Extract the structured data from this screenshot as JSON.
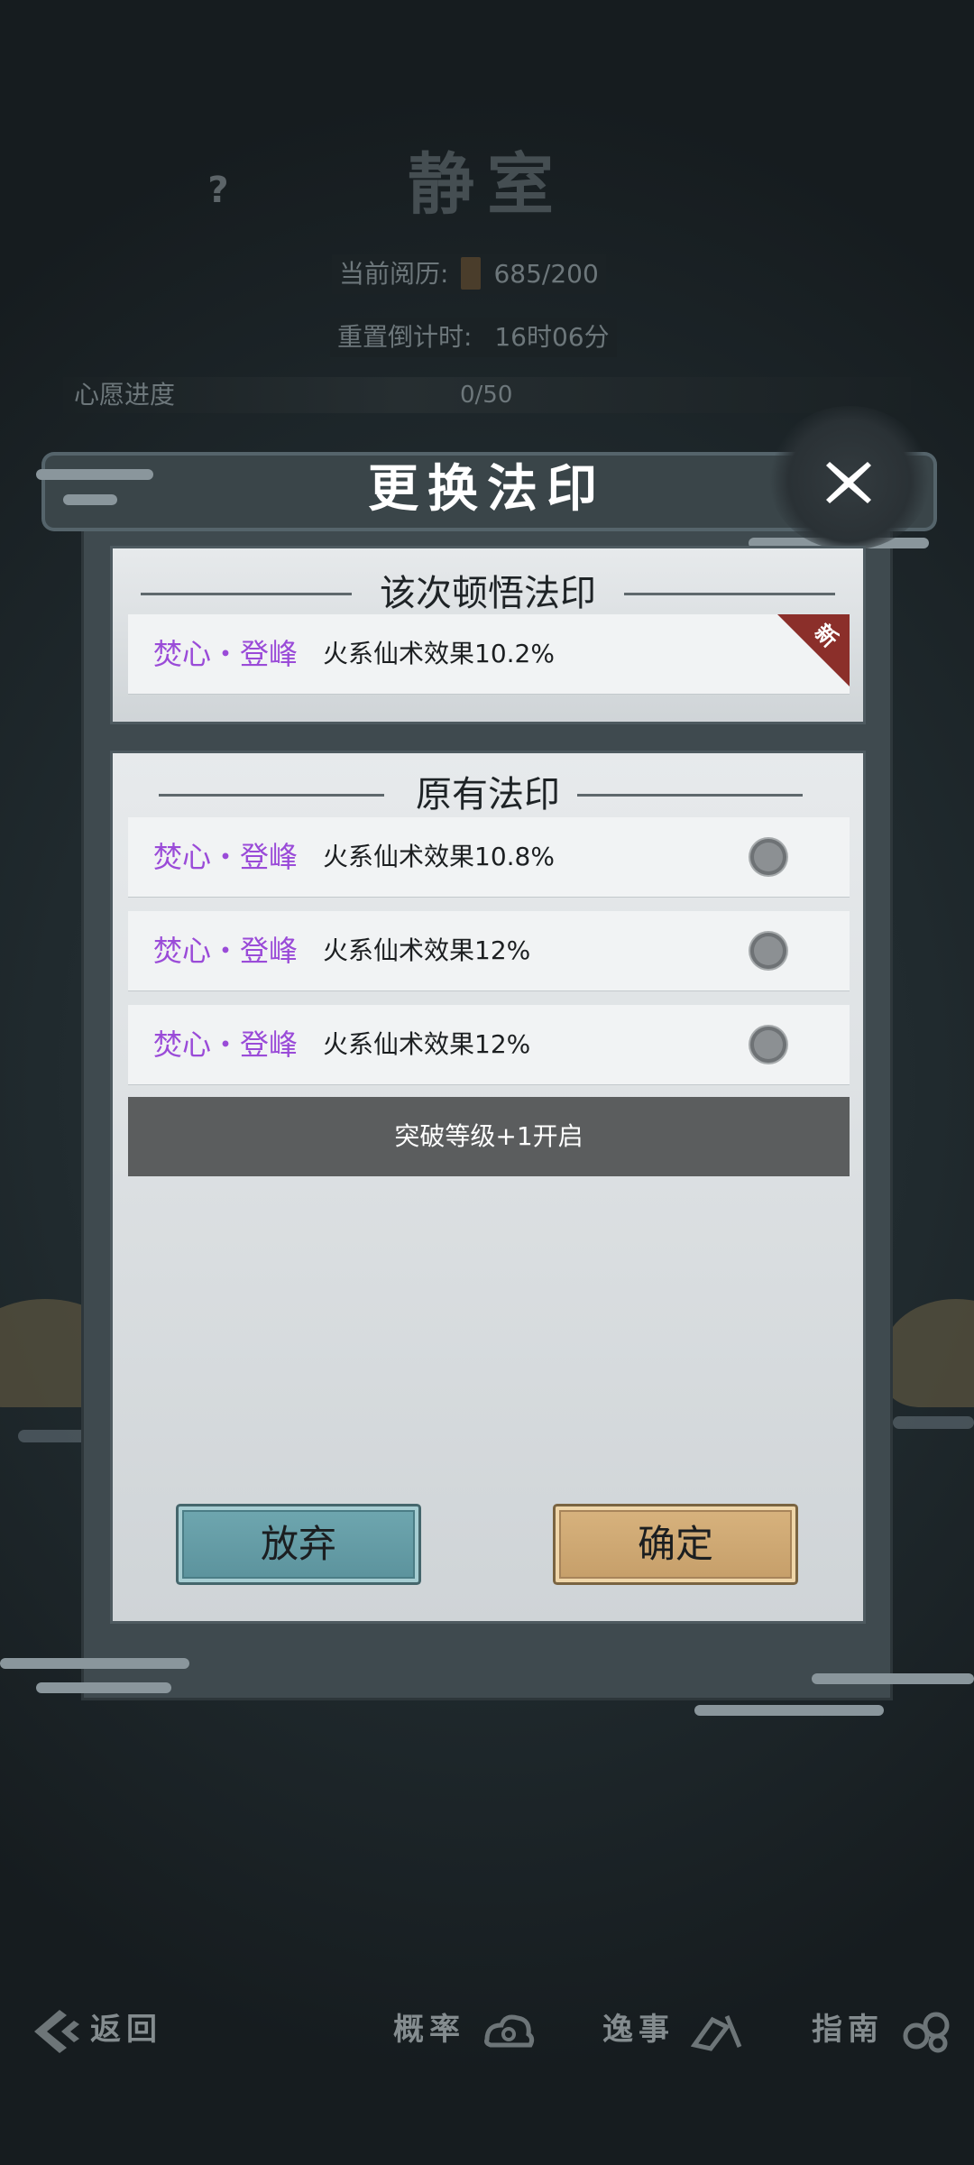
{
  "background": {
    "help_icon": "?",
    "room_title": "静室",
    "experience_label": "当前阅历:",
    "experience_value": "685/200",
    "reset_label": "重置倒计时:",
    "reset_value": "16时06分",
    "wish_label": "心愿进度",
    "wish_value": "0/50"
  },
  "dialog": {
    "title": "更换法印",
    "close_icon": "close-icon",
    "new_section": {
      "title": "该次顿悟法印",
      "seal": {
        "name": "焚心・登峰",
        "effect": "火系仙术效果10.2%",
        "badge": "新"
      }
    },
    "existing_section": {
      "title": "原有法印",
      "seals": [
        {
          "name": "焚心・登峰",
          "effect": "火系仙术效果10.8%"
        },
        {
          "name": "焚心・登峰",
          "effect": "火系仙术效果12%"
        },
        {
          "name": "焚心・登峰",
          "effect": "火系仙术效果12%"
        }
      ],
      "locked_slot": "突破等级+1开启"
    },
    "buttons": {
      "give_up": "放弃",
      "confirm": "确定"
    }
  },
  "bottom_nav": {
    "back": "返回",
    "tab1": "概率",
    "tab2": "逸事",
    "tab3": "指南"
  },
  "colors": {
    "seal_name": "#9a4bd8",
    "give_up_button": "#6fa7b0",
    "confirm_button": "#d8b37e",
    "new_badge": "#8b2f2a"
  }
}
